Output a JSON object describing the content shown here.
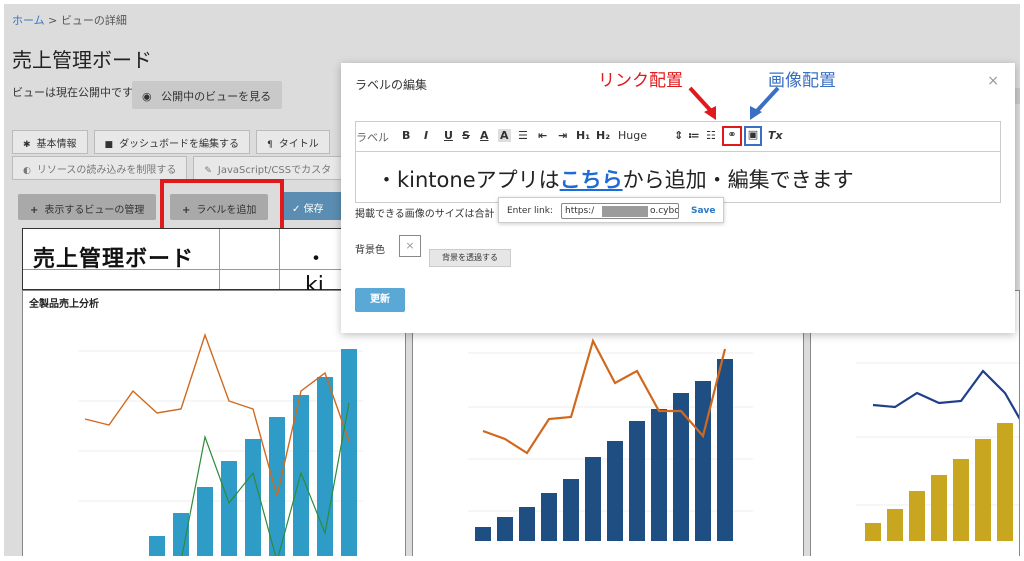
{
  "breadcrumb": {
    "home": "ホーム",
    "sep": ">",
    "current": "ビューの詳細"
  },
  "page": {
    "title": "売上管理ボード",
    "status": "ビューは現在公開中です",
    "view_public_label": "公開中のビューを見る"
  },
  "tabs_row1": [
    {
      "label": "基本情報",
      "icon": "gear-icon"
    },
    {
      "label": "ダッシュボードを編集する",
      "icon": "grid-icon"
    },
    {
      "label": "タイトル",
      "icon": "paragraph-icon"
    }
  ],
  "tabs_row2": [
    {
      "label": "リソースの読み込みを制限する",
      "icon": "shield-icon"
    },
    {
      "label": "JavaScript/CSSでカスタ",
      "icon": "wrench-icon"
    }
  ],
  "actions": {
    "manage_views": "表示するビューの管理",
    "add_label": "ラベルを追加",
    "save": "保存"
  },
  "label_preview": {
    "title": "売上管理ボード",
    "snippet": "・ki"
  },
  "chart_title": "全製品売上分析",
  "modal": {
    "title": "ラベルの編集",
    "close": "×",
    "label_field": "ラベル",
    "toolbar": {
      "bold": "B",
      "italic": "I",
      "underline": "U",
      "strike": "S",
      "color": "A",
      "highlight": "A",
      "h1": "H₁",
      "h2": "H₂",
      "size": "Huge",
      "clear": "Tx"
    },
    "editor_prefix": "・kintoneアプリは",
    "editor_link": "こちら",
    "editor_suffix": "から追加・編集できます",
    "link_popup": {
      "label": "Enter link:",
      "value_start": "https:/",
      "value_end": "o.cybo",
      "save": "Save"
    },
    "hint": "掲載できる画像のサイズは合計",
    "bg_label": "背景色",
    "swatch": "×",
    "transparent": "背景を透過する",
    "update": "更新"
  },
  "callouts": {
    "link": "リンク配置",
    "image": "画像配置"
  },
  "colors": {
    "red": "#e0191d",
    "blue": "#3a6fc4",
    "bar1": "#2f9cc7",
    "bar2": "#1f4f82",
    "bar3": "#c8a620",
    "line_orange": "#d0691d",
    "line_green": "#2e8b3a"
  }
}
